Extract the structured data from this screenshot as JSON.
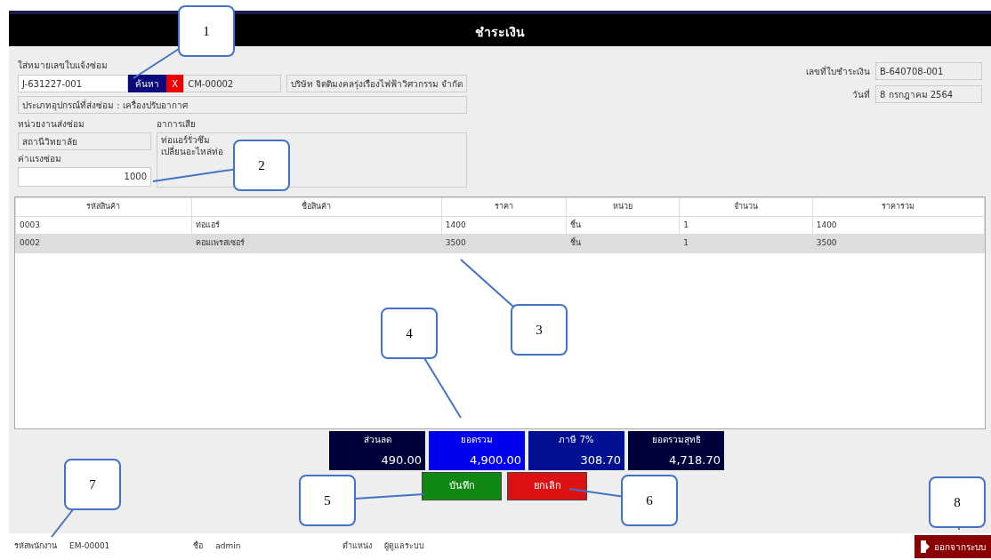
{
  "window": {
    "title": "ชำระเงิน"
  },
  "search": {
    "label": "ใส่หมายเลขใบแจ้งซ่อม",
    "value": "J-631227-001",
    "search_button": "ค้นหา",
    "clear_button": "X",
    "customer_id": "CM-00002",
    "customer_name": "บริษัท จิตติมงคลรุ่งเรืองไฟฟ้าวิศวกรรม จำกัด"
  },
  "device": "ประเภทอุปกรณ์ที่ส่งซ่อม : เครื่องปรับอากาศ",
  "department": {
    "label": "หน่วยงานส่งซ่อม",
    "value": "สถานีวิทยาลัย"
  },
  "labor": {
    "label": "ค่าแรงซ่อม",
    "value": "1000"
  },
  "symptom": {
    "label": "อาการเสีย",
    "lines": [
      "ท่อแอร์รั่วซึม",
      "เปลี่ยนอะไหล่ท่อ"
    ]
  },
  "receipt": {
    "number_label": "เลขที่ใบชำระเงิน",
    "number": "B-640708-001",
    "date_label": "วันที่",
    "date": "8 กรกฎาคม 2564"
  },
  "table": {
    "columns": [
      "รหัสสินค้า",
      "ชื่อสินค้า",
      "ราคา",
      "หน่วย",
      "จำนวน",
      "ราคารวม"
    ],
    "rows": [
      {
        "selected": false,
        "cells": [
          "0003",
          "ท่อแอร์",
          "1400",
          "ชิ้น",
          "1",
          "1400"
        ]
      },
      {
        "selected": true,
        "cells": [
          "0002",
          "คอมเพรสเซอร์",
          "3500",
          "ชิ้น",
          "1",
          "3500"
        ]
      }
    ]
  },
  "totals": [
    {
      "label": "ส่วนลด",
      "value": "490.00",
      "kind": "dark"
    },
    {
      "label": "ยอดรวม",
      "value": "4,900.00",
      "kind": "bright"
    },
    {
      "label": "ภาษี 7%",
      "value": "308.70",
      "kind": "mid"
    },
    {
      "label": "ยอดรวมสุทธิ",
      "value": "4,718.70",
      "kind": "dark"
    }
  ],
  "buttons": [
    {
      "label": "บันทึก",
      "kind": "save"
    },
    {
      "label": "ยกเลิก",
      "kind": "cancel"
    }
  ],
  "status_bar": {
    "employee_label": "รหัสพนักงาน",
    "employee": "EM-00001",
    "name_label": "ชื่อ",
    "name": "admin",
    "role_label": "ตำแหน่ง",
    "role": "ผู้ดูแลระบบ",
    "exit": "ออกจากระบบ"
  },
  "callouts": [
    "1",
    "2",
    "3",
    "4",
    "5",
    "6",
    "7",
    "8"
  ]
}
